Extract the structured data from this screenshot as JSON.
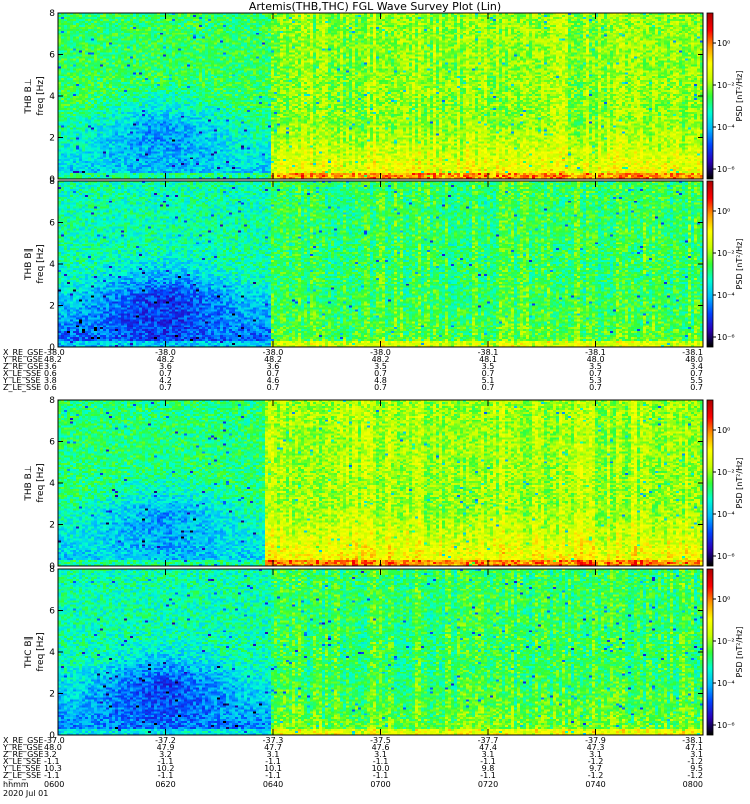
{
  "chart_data": {
    "type": "heatmap",
    "title": "Artemis(THB,THC) FGL Wave Survey Plot (Lin)",
    "colorbar": {
      "label": "PSD [nT²/Hz]",
      "scale": "log",
      "ticks": [
        "10⁰",
        "10⁻²",
        "10⁻⁴",
        "10⁻⁶"
      ],
      "colormap": [
        "#000000",
        "#2b00b8",
        "#0044ff",
        "#00b8ff",
        "#00ffd0",
        "#33ff33",
        "#c8ff00",
        "#ffff00",
        "#ff9900",
        "#ff0000",
        "#b00000"
      ]
    },
    "x_axis": {
      "label": "hhmm",
      "tick_labels": [
        "0600",
        "0620",
        "0640",
        "0700",
        "0720",
        "0740",
        "0800"
      ],
      "date": "2020 Jul 01"
    },
    "y_axis": {
      "ylim": [
        0,
        8
      ],
      "ticks": [
        0,
        2,
        4,
        6,
        8
      ]
    },
    "panels": [
      {
        "probe_label": "THB B⊥",
        "ylabel": "freq [Hz]",
        "profile": {
          "transition": 0.33,
          "early_low": 0.32,
          "early_high": 0.48,
          "late_low": 0.68,
          "late_high": 0.56,
          "blue_patch": 0.16
        }
      },
      {
        "probe_label": "THB B∥",
        "ylabel": "freq [Hz]",
        "profile": {
          "transition": 0.33,
          "early_low": 0.2,
          "early_high": 0.42,
          "late_low": 0.52,
          "late_high": 0.48,
          "blue_patch": 0.18
        }
      },
      {
        "probe_label": "THB B⊥",
        "ylabel": "freq [Hz]",
        "profile": {
          "transition": 0.32,
          "early_low": 0.32,
          "early_high": 0.46,
          "late_low": 0.7,
          "late_high": 0.58,
          "blue_patch": 0.14
        }
      },
      {
        "probe_label": "THC B∥",
        "ylabel": "freq [Hz]",
        "profile": {
          "transition": 0.33,
          "early_low": 0.24,
          "early_high": 0.42,
          "late_low": 0.54,
          "late_high": 0.48,
          "blue_patch": 0.18
        }
      }
    ],
    "ephemeris": [
      {
        "probe": "THB",
        "rows": [
          {
            "label": "X_RE_GSE",
            "values": [
              "-38.0",
              "-38.0",
              "-38.0",
              "-38.0",
              "-38.1",
              "-38.1",
              "-38.1"
            ]
          },
          {
            "label": "Y_RE_GSE",
            "values": [
              "48.2",
              "48.2",
              "48.2",
              "48.2",
              "48.1",
              "48.0",
              "48.0"
            ]
          },
          {
            "label": "Z_RE_GSE",
            "values": [
              "3.6",
              "3.6",
              "3.6",
              "3.5",
              "3.5",
              "3.5",
              "3.4"
            ]
          },
          {
            "label": "X_LE_SSE",
            "values": [
              "0.6",
              "0.7",
              "0.7",
              "0.7",
              "0.7",
              "0.7",
              "0.7"
            ]
          },
          {
            "label": "Y_LE_SSE",
            "values": [
              "3.8",
              "4.2",
              "4.6",
              "4.8",
              "5.1",
              "5.3",
              "5.5"
            ]
          },
          {
            "label": "Z_LE_SSE",
            "values": [
              "0.6",
              "0.7",
              "0.7",
              "0.7",
              "0.7",
              "0.7",
              "0.7"
            ]
          }
        ]
      },
      {
        "probe": "THC",
        "rows": [
          {
            "label": "X_RE_GSE",
            "values": [
              "-37.0",
              "-37.2",
              "-37.3",
              "-37.5",
              "-37.7",
              "-37.9",
              "-38.1"
            ]
          },
          {
            "label": "Y_RE_GSE",
            "values": [
              "48.0",
              "47.9",
              "47.7",
              "47.6",
              "47.4",
              "47.3",
              "47.1"
            ]
          },
          {
            "label": "Z_RE_GSE",
            "values": [
              "3.2",
              "3.2",
              "3.1",
              "3.1",
              "3.1",
              "3.1",
              "3.1"
            ]
          },
          {
            "label": "X_LE_SSE",
            "values": [
              "-1.1",
              "-1.1",
              "-1.1",
              "-1.1",
              "-1.1",
              "-1.2",
              "-1.2"
            ]
          },
          {
            "label": "Y_LE_SSE",
            "values": [
              "10.3",
              "10.2",
              "10.1",
              "10.0",
              "9.8",
              "9.7",
              "9.5"
            ]
          },
          {
            "label": "Z_LE_SSE",
            "values": [
              "-1.1",
              "-1.1",
              "-1.1",
              "-1.1",
              "-1.1",
              "-1.2",
              "-1.2"
            ]
          }
        ]
      }
    ]
  }
}
